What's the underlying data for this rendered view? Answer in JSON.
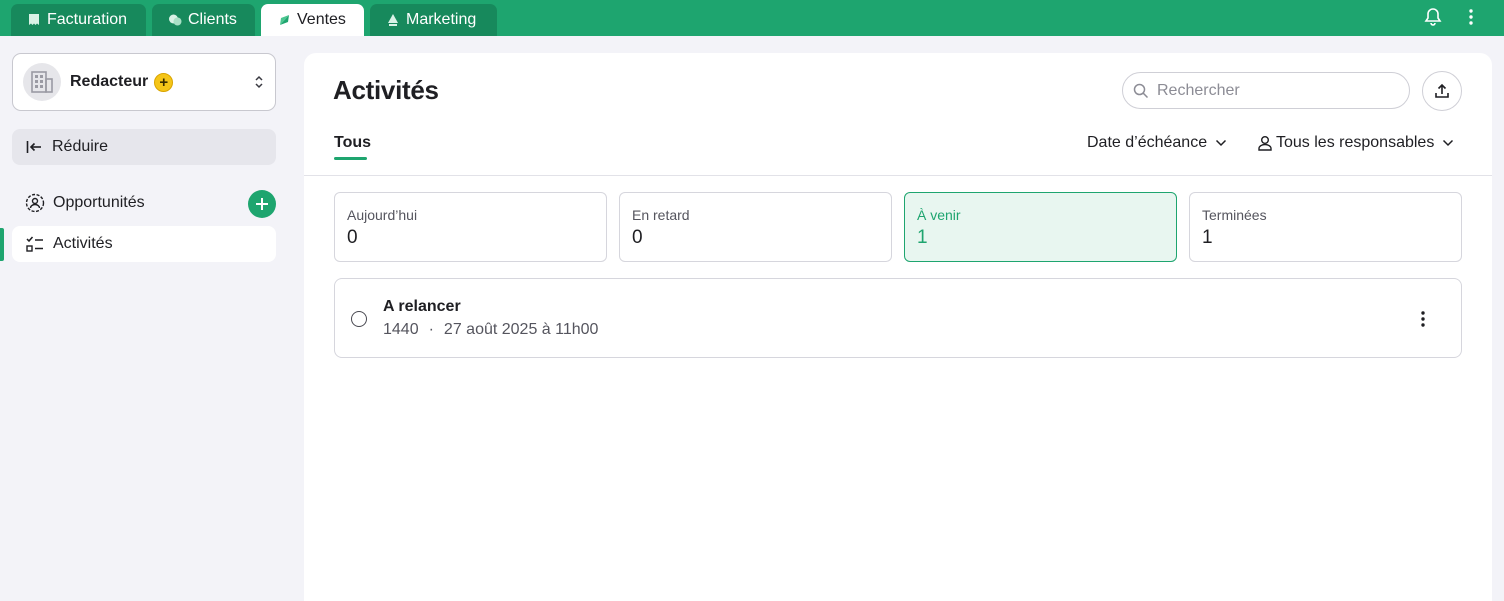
{
  "topbar": {
    "tabs": [
      {
        "label": "Facturation",
        "icon": "invoice-icon"
      },
      {
        "label": "Clients",
        "icon": "clients-icon"
      },
      {
        "label": "Ventes",
        "icon": "sales-icon",
        "active": true
      },
      {
        "label": "Marketing",
        "icon": "marketing-icon"
      }
    ],
    "icons": [
      "bell-icon",
      "more-vertical-icon"
    ]
  },
  "sidebar": {
    "org": {
      "name": "Redacteur",
      "badge": "+"
    },
    "collapse_label": "Réduire",
    "items": [
      {
        "label": "Opportunités",
        "icon": "opportunities-icon"
      },
      {
        "label": "Activités",
        "icon": "activities-icon",
        "active": true
      }
    ]
  },
  "main": {
    "title": "Activités",
    "search": {
      "placeholder": "Rechercher",
      "value": ""
    },
    "tab": "Tous",
    "filters": {
      "date": "Date d’échéance",
      "owner": "Tous les responsables"
    },
    "summary": [
      {
        "label": "Aujourd’hui",
        "value": "0"
      },
      {
        "label": "En retard",
        "value": "0"
      },
      {
        "label": "À venir",
        "value": "1",
        "active": true
      },
      {
        "label": "Terminées",
        "value": "1"
      }
    ],
    "activities": [
      {
        "title": "A relancer",
        "reference": "1440",
        "separator": "·",
        "due": "27 août 2025 à 11h00"
      }
    ]
  },
  "colors": {
    "accent": "#1ea56f",
    "accent_dark": "#17895c",
    "badge": "#f5c518"
  }
}
